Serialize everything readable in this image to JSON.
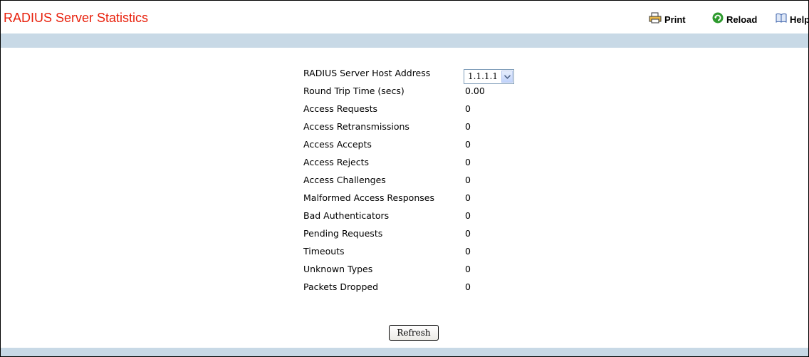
{
  "header": {
    "title": "RADIUS Server Statistics",
    "print_label": "Print",
    "reload_label": "Reload",
    "help_label": "Help"
  },
  "server": {
    "host_label": "RADIUS Server Host Address",
    "host_value": "1.1.1.1"
  },
  "stats": [
    {
      "label": "Round Trip Time (secs)",
      "value": "0.00"
    },
    {
      "label": "Access Requests",
      "value": "0"
    },
    {
      "label": "Access Retransmissions",
      "value": "0"
    },
    {
      "label": "Access Accepts",
      "value": "0"
    },
    {
      "label": "Access Rejects",
      "value": "0"
    },
    {
      "label": "Access Challenges",
      "value": "0"
    },
    {
      "label": "Malformed Access Responses",
      "value": "0"
    },
    {
      "label": "Bad Authenticators",
      "value": "0"
    },
    {
      "label": "Pending Requests",
      "value": "0"
    },
    {
      "label": "Timeouts",
      "value": "0"
    },
    {
      "label": "Unknown Types",
      "value": "0"
    },
    {
      "label": "Packets Dropped",
      "value": "0"
    }
  ],
  "actions": {
    "refresh_label": "Refresh"
  },
  "colors": {
    "title": "#e8200c",
    "band": "#c8d9e6"
  }
}
